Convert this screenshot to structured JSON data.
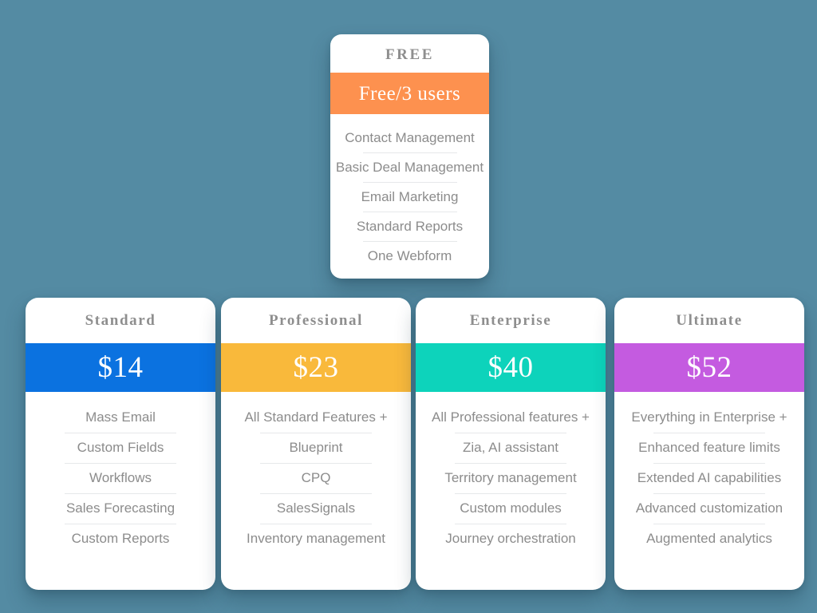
{
  "background_color": "#548ba3",
  "featured_plan": {
    "name": "FREE",
    "price_label": "Free/3 users",
    "accent_color": "#fd914f",
    "features": [
      "Contact Management",
      "Basic Deal Management",
      "Email Marketing",
      "Standard Reports",
      "One Webform"
    ]
  },
  "plans": [
    {
      "name": "Standard",
      "price_label": "$14",
      "accent_color": "#0b72e0",
      "features": [
        "Mass Email",
        "Custom Fields",
        "Workflows",
        "Sales Forecasting",
        "Custom Reports"
      ]
    },
    {
      "name": "Professional",
      "price_label": "$23",
      "accent_color": "#f9b93b",
      "features": [
        "All Standard Features +",
        "Blueprint",
        "CPQ",
        "SalesSignals",
        "Inventory management"
      ]
    },
    {
      "name": "Enterprise",
      "price_label": "$40",
      "accent_color": "#0dd3bb",
      "features": [
        "All Professional features +",
        "Zia, AI assistant",
        "Territory management",
        "Custom modules",
        "Journey orchestration"
      ]
    },
    {
      "name": "Ultimate",
      "price_label": "$52",
      "accent_color": "#c45be0",
      "features": [
        "Everything in Enterprise +",
        "Enhanced feature limits",
        "Extended AI capabilities",
        "Advanced customization",
        "Augmented analytics"
      ]
    }
  ]
}
